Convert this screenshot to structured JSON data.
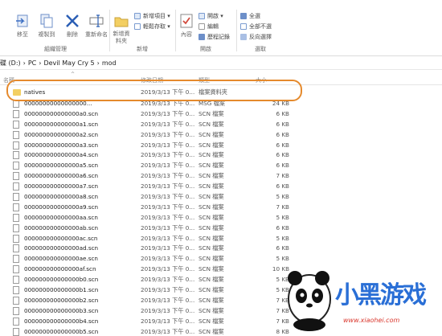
{
  "ribbon": {
    "organize": {
      "label": "組織管理",
      "buttons": [
        "移至",
        "複製到",
        "刪除",
        "重新命名"
      ]
    },
    "new": {
      "label": "新增",
      "big_button": "新增資料夾",
      "items": [
        "新增項目 ▾",
        "輕鬆存取 ▾"
      ]
    },
    "open": {
      "label": "開啟",
      "big_button": "內容",
      "items": [
        "開啟 ▾",
        "編輯",
        "歷程記錄"
      ]
    },
    "select": {
      "label": "選取",
      "items": [
        "全選",
        "全部不選",
        "反向選擇"
      ]
    }
  },
  "breadcrumb": [
    "碟 (D:)",
    "›",
    "PC",
    "›",
    "Devil May Cry 5",
    "›",
    "mod"
  ],
  "columns": [
    "名稱",
    "修改日期",
    "類型",
    "大小"
  ],
  "folder_row": {
    "name": "natives",
    "date": "2019/3/13 下午 0...",
    "type": "檔案資料夾",
    "size": ""
  },
  "files": [
    {
      "name": "00000000000000000...",
      "date": "2019/3/13 下午 0...",
      "type": "MSG 檔案",
      "size": "24 KB"
    },
    {
      "name": "000000000000000a0.scn",
      "date": "2019/3/13 下午 0...",
      "type": "SCN 檔案",
      "size": "6 KB"
    },
    {
      "name": "000000000000000a1.scn",
      "date": "2019/3/13 下午 0...",
      "type": "SCN 檔案",
      "size": "6 KB"
    },
    {
      "name": "000000000000000a2.scn",
      "date": "2019/3/13 下午 0...",
      "type": "SCN 檔案",
      "size": "6 KB"
    },
    {
      "name": "000000000000000a3.scn",
      "date": "2019/3/13 下午 0...",
      "type": "SCN 檔案",
      "size": "6 KB"
    },
    {
      "name": "000000000000000a4.scn",
      "date": "2019/3/13 下午 0...",
      "type": "SCN 檔案",
      "size": "6 KB"
    },
    {
      "name": "000000000000000a5.scn",
      "date": "2019/3/13 下午 0...",
      "type": "SCN 檔案",
      "size": "6 KB"
    },
    {
      "name": "000000000000000a6.scn",
      "date": "2019/3/13 下午 0...",
      "type": "SCN 檔案",
      "size": "7 KB"
    },
    {
      "name": "000000000000000a7.scn",
      "date": "2019/3/13 下午 0...",
      "type": "SCN 檔案",
      "size": "6 KB"
    },
    {
      "name": "000000000000000a8.scn",
      "date": "2019/3/13 下午 0...",
      "type": "SCN 檔案",
      "size": "5 KB"
    },
    {
      "name": "000000000000000a9.scn",
      "date": "2019/3/13 下午 0...",
      "type": "SCN 檔案",
      "size": "7 KB"
    },
    {
      "name": "000000000000000aa.scn",
      "date": "2019/3/13 下午 0...",
      "type": "SCN 檔案",
      "size": "5 KB"
    },
    {
      "name": "000000000000000ab.scn",
      "date": "2019/3/13 下午 0...",
      "type": "SCN 檔案",
      "size": "6 KB"
    },
    {
      "name": "000000000000000ac.scn",
      "date": "2019/3/13 下午 0...",
      "type": "SCN 檔案",
      "size": "5 KB"
    },
    {
      "name": "000000000000000ad.scn",
      "date": "2019/3/13 下午 0...",
      "type": "SCN 檔案",
      "size": "6 KB"
    },
    {
      "name": "000000000000000ae.scn",
      "date": "2019/3/13 下午 0...",
      "type": "SCN 檔案",
      "size": "5 KB"
    },
    {
      "name": "000000000000000af.scn",
      "date": "2019/3/13 下午 0...",
      "type": "SCN 檔案",
      "size": "10 KB"
    },
    {
      "name": "000000000000000b0.scn",
      "date": "2019/3/13 下午 0...",
      "type": "SCN 檔案",
      "size": "5 KB"
    },
    {
      "name": "000000000000000b1.scn",
      "date": "2019/3/13 下午 0...",
      "type": "SCN 檔案",
      "size": "5 KB"
    },
    {
      "name": "000000000000000b2.scn",
      "date": "2019/3/13 下午 0...",
      "type": "SCN 檔案",
      "size": "7 KB"
    },
    {
      "name": "000000000000000b3.scn",
      "date": "2019/3/13 下午 0...",
      "type": "SCN 檔案",
      "size": "7 KB"
    },
    {
      "name": "000000000000000b4.scn",
      "date": "2019/3/13 下午 0...",
      "type": "SCN 檔案",
      "size": "7 KB"
    },
    {
      "name": "000000000000000b5.scn",
      "date": "2019/3/13 下午 0...",
      "type": "SCN 檔案",
      "size": "8 KB"
    }
  ],
  "watermark": {
    "title": "小黑游戏",
    "url": "www.xiaohei.com"
  },
  "colors": {
    "highlight": "#e58a2d",
    "folder": "#f3cf62",
    "watermark_blue": "#2a6fd6",
    "watermark_red": "#d9352b"
  }
}
